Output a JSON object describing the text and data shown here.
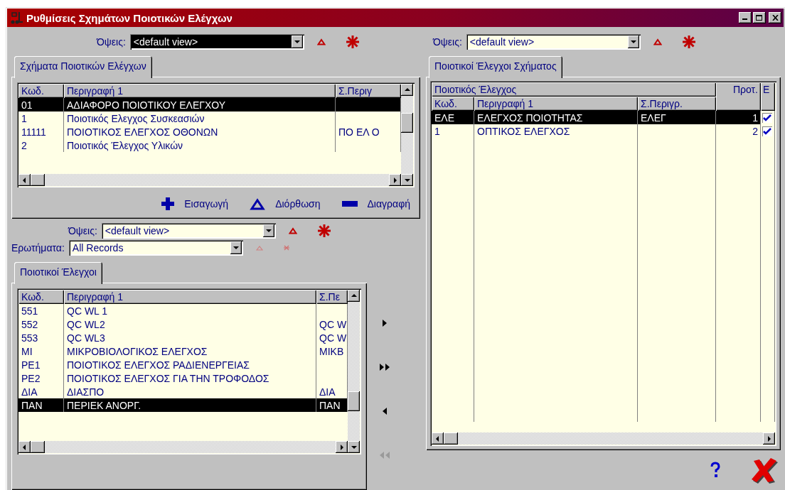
{
  "window": {
    "title": "Ρυθμίσεις Σχημάτων Ποιοτικών Ελέγχων"
  },
  "left": {
    "views": {
      "label": "Όψεις:",
      "value": "<default view>",
      "selected": true
    },
    "schemes_tabs": [
      {
        "label": "Σχήματα Ποιοτικών Ελέγχων",
        "selected": true
      }
    ],
    "schemes_table": {
      "columns": [
        "Κωδ.",
        "Περιγραφή 1",
        "Σ.Περιγ"
      ],
      "rows": [
        {
          "code": "01",
          "description": "ΑΔΙΑΦΟΡΟ ΠΟΙΟΤΙΚΟΥ ΕΛΕΓΧΟΥ",
          "selected": true
        },
        {
          "code": "1",
          "description": "Ποιοτικός Ελεγχος Συσκεασιών",
          "selected": false
        },
        {
          "code": "11111",
          "description": "ΠΟΙΟΤΙΚΟΣ ΕΛΕΓΧΟΣ ΟΘΟΝΩΝ",
          "short": "ΠΟ ΕΛ Ο",
          "selected": false
        },
        {
          "code": "2",
          "description": "Ποιοτικός Έλεγχος Υλικών",
          "selected": false
        }
      ]
    },
    "actions": [
      {
        "kind": "insert",
        "label": "Εισαγωγή"
      },
      {
        "kind": "edit",
        "label": "Διόρθωση"
      },
      {
        "kind": "delete",
        "label": "Διαγραφή"
      }
    ],
    "views_2": {
      "label": "Όψεις:",
      "value": "<default view>",
      "selected": false
    },
    "queries": {
      "label": "Ερωτήματα:",
      "value": "All Records",
      "selected": false,
      "disabled": true
    },
    "checks_tabs": [
      {
        "label": "Ποιοτικοί Έλεγχοι",
        "selected": true
      }
    ],
    "checks_table": {
      "columns": [
        "Κωδ.",
        "Περιγραφή 1",
        "Σ.Πε"
      ],
      "rows": [
        {
          "code": "551",
          "description": "QC WL 1",
          "selected": false
        },
        {
          "code": "552",
          "description": "QC WL2",
          "short": "QC W",
          "selected": false
        },
        {
          "code": "553",
          "description": "QC WL3",
          "short": "QC W",
          "selected": false
        },
        {
          "code": "MI",
          "description": "ΜΙΚΡΟΒΙΟΛΟΓΙΚΟΣ ΕΛΕΓΧΟΣ",
          "short": "ΜΙΚΒ",
          "selected": false
        },
        {
          "code": "PE1",
          "description": "ΠΟΙΟΤΙΚΟΣ ΕΛΕΓΧΟΣ ΡΑΔΙΕΝΕΡΓΕΙΑΣ",
          "selected": false
        },
        {
          "code": "PE2",
          "description": "ΠΟΙΟΤΙΚΟΣ ΕΛΕΓΧΟΣ ΓΙΑ ΤΗΝ ΤΡΟΦΟΔΟΣ",
          "selected": false
        },
        {
          "code": "ΔΙΑ",
          "description": "ΔΙΑΣΠΟ",
          "short": "ΔΙΑ",
          "selected": false
        },
        {
          "code": "ΠΑΝ",
          "description": "ΠΕΡΙΕΚ ΑΝΟΡΓ.",
          "short": "ΠΑΝ",
          "selected": true
        }
      ]
    },
    "transfer_buttons": [
      {
        "kind": "add",
        "disabled": false
      },
      {
        "kind": "add_all",
        "disabled": false
      },
      {
        "kind": "remove",
        "disabled": false
      },
      {
        "kind": "remove_all",
        "disabled": true
      }
    ]
  },
  "right": {
    "views": {
      "label": "Όψεις:",
      "value": "<default view>",
      "selected": false
    },
    "tabs": [
      {
        "label": "Ποιοτικοί Έλεγχοι Σχήματος",
        "selected": true
      }
    ],
    "table": {
      "group_header": "Ποιοτικός Έλεγχος",
      "columns": [
        "Κωδ.",
        "Περιγραφή 1",
        "Σ.Περιγρ.",
        "Προτ.",
        "Ε"
      ],
      "rows": [
        {
          "code": "ΕΛΕ",
          "description": "ΕΛΕΓΧΟΣ ΠΟΙΟΤΗΤΑΣ",
          "short": "ΕΛΕΓ",
          "priority": "1",
          "checked": true,
          "selected": true
        },
        {
          "code": "1",
          "description": "ΟΠΤΙΚΟΣ ΕΛΕΓΧΟΣ",
          "priority": "2",
          "checked": true,
          "selected": false
        }
      ]
    }
  },
  "footer_buttons": [
    {
      "kind": "help"
    },
    {
      "kind": "close"
    }
  ]
}
